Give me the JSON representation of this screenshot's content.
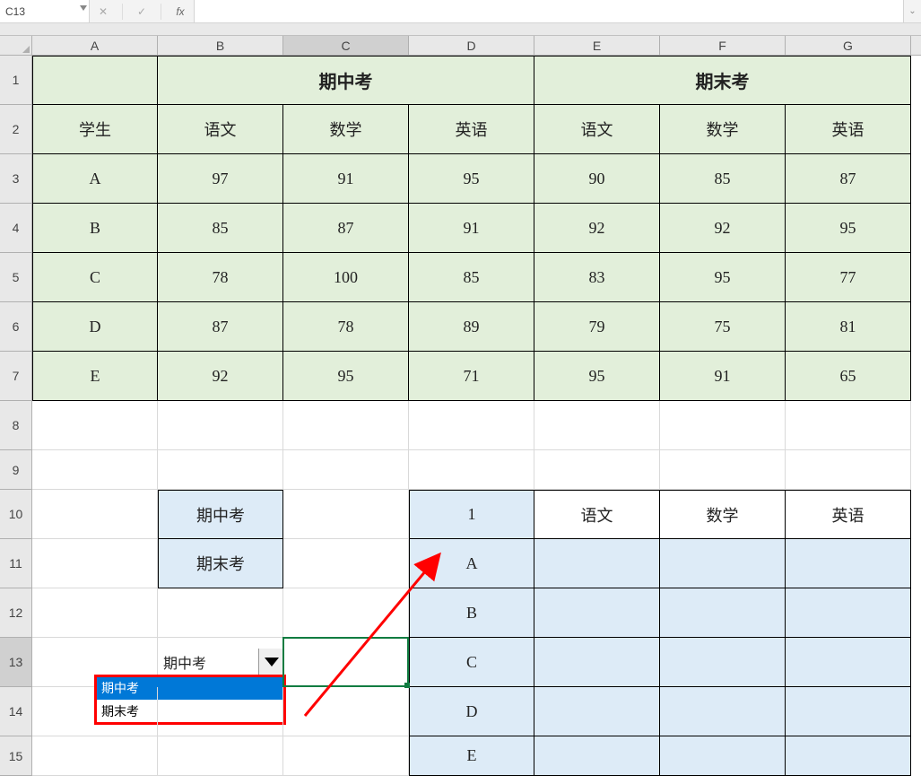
{
  "name_box": "C13",
  "fx_label": "fx",
  "columns": [
    "A",
    "B",
    "C",
    "D",
    "E",
    "F",
    "G"
  ],
  "row_numbers": [
    "1",
    "2",
    "3",
    "4",
    "5",
    "6",
    "7",
    "8",
    "9",
    "10",
    "11",
    "12",
    "13",
    "14",
    "15"
  ],
  "merged_headers": {
    "mid": "期中考",
    "final": "期末考"
  },
  "col_labels": {
    "student": "学生",
    "mid_chinese": "语文",
    "mid_math": "数学",
    "mid_english": "英语",
    "fin_chinese": "语文",
    "fin_math": "数学",
    "fin_english": "英语"
  },
  "students": [
    "A",
    "B",
    "C",
    "D",
    "E"
  ],
  "scores": [
    [
      97,
      91,
      95,
      90,
      85,
      87
    ],
    [
      85,
      87,
      91,
      92,
      92,
      95
    ],
    [
      78,
      100,
      85,
      83,
      95,
      77
    ],
    [
      87,
      78,
      89,
      79,
      75,
      81
    ],
    [
      92,
      95,
      71,
      95,
      91,
      65
    ]
  ],
  "options_col": {
    "opt1": "期中考",
    "opt2": "期末考"
  },
  "dropdown": {
    "value": "期中考",
    "opt1": "期中考",
    "opt2": "期末考"
  },
  "lookup": {
    "d10": "1",
    "e10": "语文",
    "f10": "数学",
    "g10": "英语",
    "d11": "A",
    "d12": "B",
    "d13": "C",
    "d14": "D",
    "d15": "E"
  },
  "active_cell": "C13"
}
